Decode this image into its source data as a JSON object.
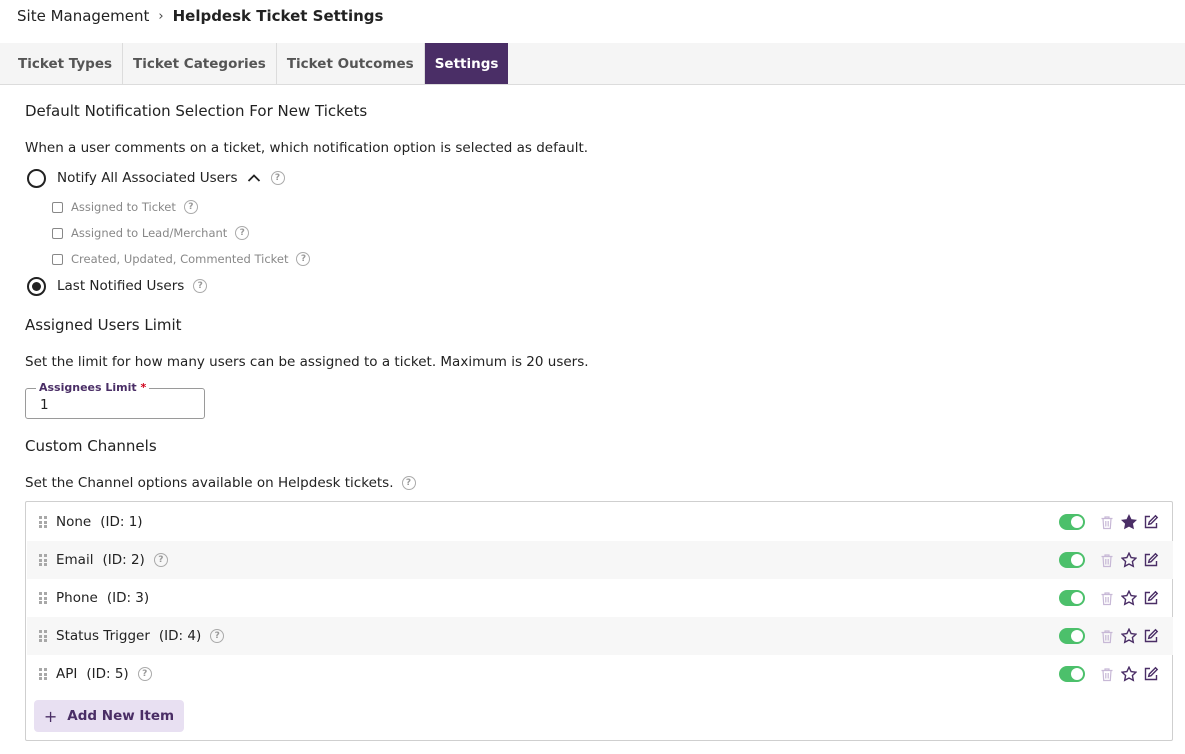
{
  "breadcrumb": {
    "parent": "Site Management",
    "current": "Helpdesk Ticket Settings"
  },
  "tabs": [
    {
      "label": "Ticket Types",
      "active": false
    },
    {
      "label": "Ticket Categories",
      "active": false
    },
    {
      "label": "Ticket Outcomes",
      "active": false
    },
    {
      "label": "Settings",
      "active": true
    }
  ],
  "notification": {
    "heading": "Default Notification Selection For New Tickets",
    "description": "When a user comments on a ticket, which notification option is selected as default.",
    "option_all": "Notify All Associated Users",
    "sub_options": [
      "Assigned to Ticket",
      "Assigned to Lead/Merchant",
      "Created, Updated, Commented Ticket"
    ],
    "option_last": "Last Notified Users"
  },
  "assigned": {
    "heading": "Assigned Users Limit",
    "description": "Set the limit for how many users can be assigned to a ticket. Maximum is 20 users.",
    "field_label": "Assignees Limit",
    "required_mark": "*",
    "field_value": "1"
  },
  "channels": {
    "heading": "Custom Channels",
    "description": "Set the Channel options available on Helpdesk tickets.",
    "items": [
      {
        "name": "None",
        "id": "(ID: 1)",
        "has_help": false,
        "enabled": true,
        "default": true
      },
      {
        "name": "Email",
        "id": "(ID: 2)",
        "has_help": true,
        "enabled": true,
        "default": false
      },
      {
        "name": "Phone",
        "id": "(ID: 3)",
        "has_help": false,
        "enabled": true,
        "default": false
      },
      {
        "name": "Status Trigger",
        "id": "(ID: 4)",
        "has_help": true,
        "enabled": true,
        "default": false
      },
      {
        "name": "API",
        "id": "(ID: 5)",
        "has_help": true,
        "enabled": true,
        "default": false
      }
    ],
    "add_label": "Add New Item"
  },
  "help_glyph": "?",
  "colors": {
    "accent": "#4a2e66",
    "toggle_on": "#4cc06b",
    "add_bg": "#e8e0f2"
  }
}
